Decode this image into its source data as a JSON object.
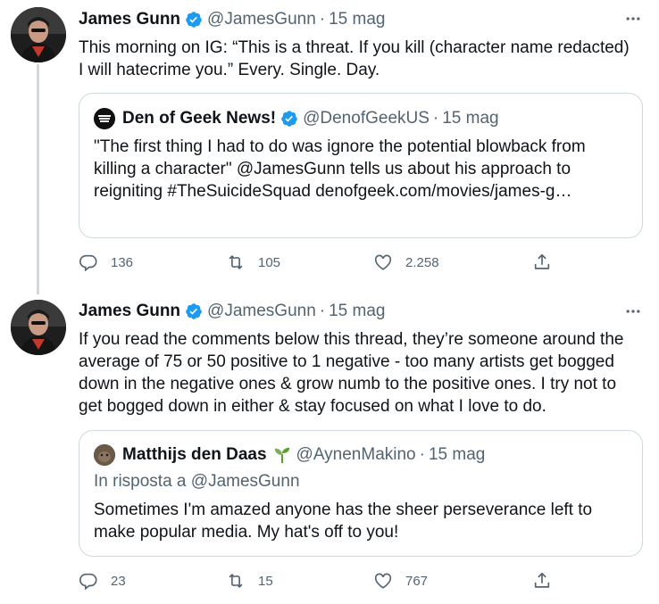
{
  "tweets": [
    {
      "author": "James Gunn",
      "handle": "@JamesGunn",
      "separator": "·",
      "date": "15 mag",
      "text": "This morning on IG: “This is a threat. If you kill (character name redacted) I will hatecrime you.” Every. Single. Day.",
      "quote": {
        "author": "Den of Geek News!",
        "handle": "@DenofGeekUS",
        "date": "15 mag",
        "text": "\"The first thing I had to do was ignore the potential blowback from killing a character\" @JamesGunn tells us about his approach to reigniting #TheSuicideSquad denofgeek.com/movies/james-g…"
      },
      "stats": {
        "replies": "136",
        "retweets": "105",
        "likes": "2.258"
      }
    },
    {
      "author": "James Gunn",
      "handle": "@JamesGunn",
      "separator": "·",
      "date": "15 mag",
      "text": "If you read the comments below this thread, they’re someone around the average of 75 or 50 positive to 1 negative - too many artists get bogged down in the negative ones & grow numb to the positive ones. I try not to get bogged down in either & stay focused on what I love to do.",
      "quote": {
        "author": "Matthijs den Daas",
        "handle": "@AynenMakino",
        "date": "15 mag",
        "reply_to": "In risposta a @JamesGunn",
        "text": "Sometimes I'm amazed anyone has the sheer perseverance left to make popular media. My hat's off to you!"
      },
      "stats": {
        "replies": "23",
        "retweets": "15",
        "likes": "767"
      }
    }
  ],
  "icons": {
    "verified": "verified-badge-icon",
    "more": "more-options-icon",
    "reply": "reply-icon",
    "retweet": "retweet-icon",
    "like": "heart-icon",
    "share": "share-icon",
    "sprout": "sprout-emoji-icon"
  },
  "colors": {
    "verified": "#1d9bf0",
    "secondary_text": "#536471",
    "border": "#cfd9de",
    "sprout": "#5aa02c"
  }
}
